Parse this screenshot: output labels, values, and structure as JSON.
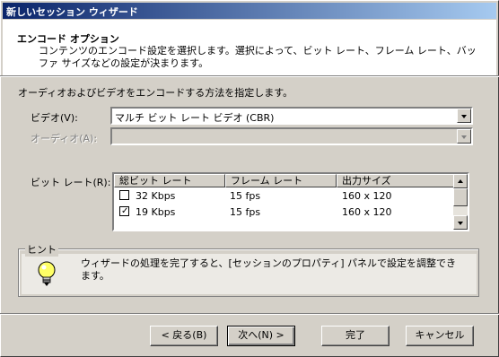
{
  "window": {
    "title": "新しいセッション ウィザード"
  },
  "header": {
    "title": "エンコード オプション",
    "description": "コンテンツのエンコード設定を選択します。選択によって、ビット レート、フレーム レート、バッファ サイズなどの設定が決まります。"
  },
  "instruction": "オーディオおよびビデオをエンコードする方法を指定します。",
  "video": {
    "label": "ビデオ(V):",
    "value": "マルチ ビット レート ビデオ (CBR)"
  },
  "audio": {
    "label": "オーディオ(A):",
    "value": ""
  },
  "bitrate": {
    "label": "ビット レート(R):",
    "columns": [
      "総ビット レート",
      "フレーム レート",
      "出力サイズ"
    ],
    "rows": [
      {
        "checked": false,
        "bitrate": "32 Kbps",
        "framerate": "15 fps",
        "size": "160 x 120"
      },
      {
        "checked": true,
        "bitrate": "19 Kbps",
        "framerate": "15 fps",
        "size": "160 x 120"
      }
    ]
  },
  "hint": {
    "legend": "ヒント",
    "text": "ウィザードの処理を完了すると、[セッションのプロパティ] パネルで設定を調整できます。",
    "icon": "lightbulb-icon"
  },
  "buttons": {
    "back": "< 戻る(B)",
    "next": "次へ(N) >",
    "finish": "完了",
    "cancel": "キャンセル"
  },
  "colors": {
    "title_bar_start": "#0a246a",
    "title_bar_end": "#a6caf0",
    "face": "#d4d0c8"
  }
}
